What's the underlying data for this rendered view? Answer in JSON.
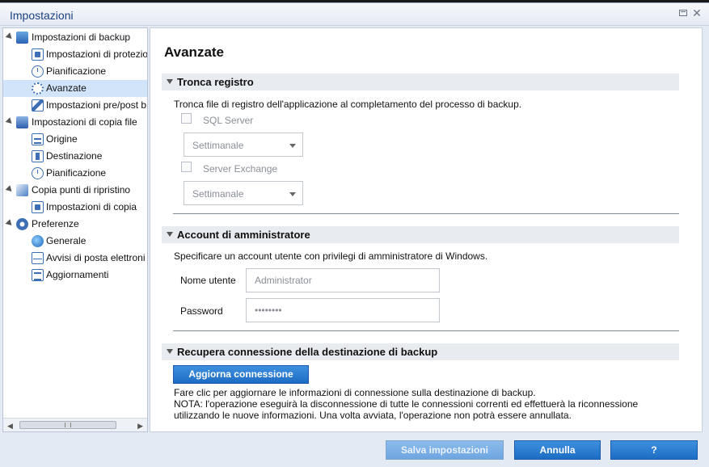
{
  "window": {
    "title": "Impostazioni"
  },
  "tree": {
    "items": [
      {
        "label": "Impostazioni di backup",
        "icon": "backup-icon",
        "expanded": true
      },
      {
        "label": "Impostazioni di protezio",
        "icon": "document-icon"
      },
      {
        "label": "Pianificazione",
        "icon": "clock-icon"
      },
      {
        "label": "Avanzate",
        "icon": "gear-icon",
        "selected": true
      },
      {
        "label": "Impostazioni pre/post b",
        "icon": "wrench-icon"
      },
      {
        "label": "Impostazioni di copia file",
        "icon": "file-copy-icon",
        "expanded": true
      },
      {
        "label": "Origine",
        "icon": "network-icon"
      },
      {
        "label": "Destinazione",
        "icon": "destination-icon"
      },
      {
        "label": "Pianificazione",
        "icon": "clock-icon"
      },
      {
        "label": "Copia punti di ripristino",
        "icon": "restore-icon",
        "expanded": true
      },
      {
        "label": "Impostazioni di copia",
        "icon": "document-icon"
      },
      {
        "label": "Preferenze",
        "icon": "preferences-icon",
        "expanded": true
      },
      {
        "label": "Generale",
        "icon": "globe-icon"
      },
      {
        "label": "Avvisi di posta elettroni",
        "icon": "mail-icon"
      },
      {
        "label": "Aggiornamenti",
        "icon": "update-icon"
      }
    ]
  },
  "content": {
    "title": "Avanzate",
    "truncate": {
      "title": "Tronca registro",
      "description": "Tronca file di registro dell'applicazione al completamento del processo di backup.",
      "sql_label": "SQL Server",
      "sql_frequency": "Settimanale",
      "exchange_label": "Server Exchange",
      "exchange_frequency": "Settimanale"
    },
    "admin": {
      "title": "Account di amministratore",
      "description": "Specificare un account utente con privilegi di amministratore di Windows.",
      "username_label": "Nome utente",
      "username_value": "Administrator",
      "password_label": "Password",
      "password_value": "••••••••"
    },
    "reconnect": {
      "title": "Recupera connessione della destinazione di backup",
      "button_label": "Aggiorna connessione",
      "line1": "Fare clic per aggiornare le informazioni di connessione sulla destinazione di backup.",
      "line2": "NOTA: l'operazione eseguirà la disconnessione di tutte le connessioni correnti ed effettuerà la riconnessione",
      "line3": "utilizzando le nuove informazioni. Una volta avviata, l'operazione non potrà essere annullata."
    }
  },
  "footer": {
    "save_label": "Salva impostazioni",
    "cancel_label": "Annulla",
    "help_label": "?"
  }
}
